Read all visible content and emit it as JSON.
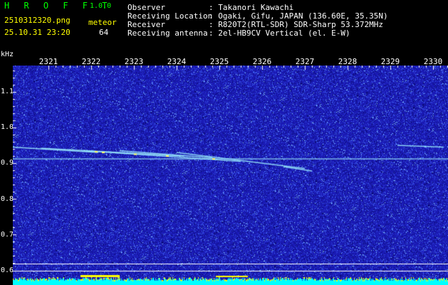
{
  "header": {
    "app_title": "H R O F F T",
    "app_version": "1.0.0",
    "filename": "2510312320.png",
    "datetime": "25.10.31 23:20",
    "meteor_label": "meteor",
    "meteor_count": "64",
    "info": [
      {
        "key": "Observer",
        "value": ": Takanori Kawachi"
      },
      {
        "key": "Receiving Location",
        "value": ": Ogaki, Gifu, JAPAN (136.60E, 35.35N)"
      },
      {
        "key": "Receiver",
        "value": ": R820T2(RTL-SDR) SDR-Sharp 53.372MHz"
      },
      {
        "key": "Receiving antenna",
        "value": ": 2el-HB9CV Vertical (el. E-W)"
      }
    ]
  },
  "plot": {
    "unit_label": "kHz",
    "y_ticks": [
      "1.1",
      "1.0",
      "0.9",
      "0.8",
      "0.7",
      "0.6"
    ],
    "x_ticks": [
      "2321",
      "2322",
      "2323",
      "2324",
      "2325",
      "2326",
      "2327",
      "2328",
      "2329",
      "2330"
    ],
    "colors": {
      "background": "#1a1ab4",
      "noise_light": "#4a6cff",
      "noise_bright": "#9ad6ff",
      "echo": "#9ff2ff",
      "echo_hot": "#ffff66",
      "activity_bar": "#00ffff",
      "activity_peak": "#ffff00",
      "guide_line": "#ffffff"
    }
  }
}
